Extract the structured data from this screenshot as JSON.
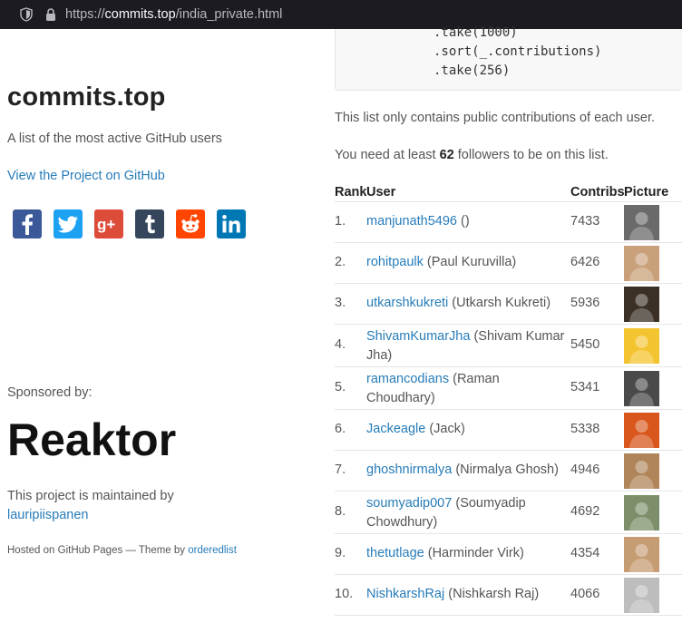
{
  "browser": {
    "url_prefix": "https://",
    "url_host": "commits.top",
    "url_path": "/india_private.html"
  },
  "sidebar": {
    "title": "commits.top",
    "tagline": "A list of the most active GitHub users",
    "project_link": "View the Project on GitHub",
    "social_icons": [
      "facebook-icon",
      "twitter-icon",
      "google-plus-icon",
      "tumblr-icon",
      "reddit-icon",
      "linkedin-icon"
    ],
    "sponsored_label": "Sponsored by:",
    "sponsor_logo_text": "Reaktor",
    "maintained_text": "This project is maintained by",
    "maintainer": "lauripiispanen",
    "hosted_text": "Hosted on GitHub Pages — Theme by",
    "theme_author": "orderedlist"
  },
  "code": {
    "lines": [
      ".take(1000)",
      ".sort(_.contributions)",
      ".take(256)"
    ]
  },
  "notes": {
    "public_only": "This list only contains public contributions of each user.",
    "followers_pre": "You need at least",
    "followers_count": "62",
    "followers_post": "followers to be on this list."
  },
  "table": {
    "headers": {
      "rank": "Rank",
      "user": "User",
      "contribs": "Contribs",
      "picture": "Picture"
    },
    "rows": [
      {
        "rank": "1.",
        "login": "manjunath5496",
        "name": "()",
        "contribs": "7433",
        "avatar": "#6a6a6a"
      },
      {
        "rank": "2.",
        "login": "rohitpaulk",
        "name": "(Paul Kuruvilla)",
        "contribs": "6426",
        "avatar": "#c9a07a"
      },
      {
        "rank": "3.",
        "login": "utkarshkukreti",
        "name": "(Utkarsh Kukreti)",
        "contribs": "5936",
        "avatar": "#3a3026"
      },
      {
        "rank": "4.",
        "login": "ShivamKumarJha",
        "name": "(Shivam Kumar Jha)",
        "contribs": "5450",
        "avatar": "#f4c430"
      },
      {
        "rank": "5.",
        "login": "ramancodians",
        "name": "(Raman Choudhary)",
        "contribs": "5341",
        "avatar": "#4a4a4a"
      },
      {
        "rank": "6.",
        "login": "Jackeagle",
        "name": "(Jack)",
        "contribs": "5338",
        "avatar": "#d9561c"
      },
      {
        "rank": "7.",
        "login": "ghoshnirmalya",
        "name": "(Nirmalya Ghosh)",
        "contribs": "4946",
        "avatar": "#b0855a"
      },
      {
        "rank": "8.",
        "login": "soumyadip007",
        "name": "(Soumyadip Chowdhury)",
        "contribs": "4692",
        "avatar": "#7c8f6a"
      },
      {
        "rank": "9.",
        "login": "thetutlage",
        "name": "(Harminder Virk)",
        "contribs": "4354",
        "avatar": "#c69c72"
      },
      {
        "rank": "10.",
        "login": "NishkarshRaj",
        "name": "(Nishkarsh Raj)",
        "contribs": "4066",
        "avatar": "#bdbdbd"
      }
    ]
  },
  "colors": {
    "link": "#267CB9",
    "facebook": "#3b5998",
    "twitter": "#1da1f2",
    "google_plus": "#dd4b39",
    "tumblr": "#35465c",
    "reddit": "#ff4500",
    "linkedin": "#0077b5"
  }
}
